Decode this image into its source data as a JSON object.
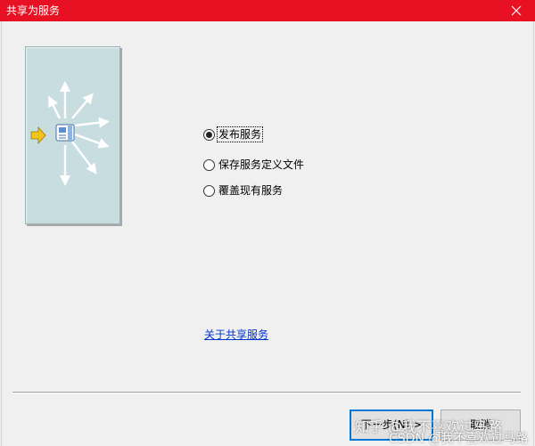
{
  "window": {
    "title": "共享为服务",
    "close_icon": "close-icon"
  },
  "illustration": {
    "icon": "publish-service-illustration"
  },
  "options": [
    {
      "label": "发布服务",
      "checked": true
    },
    {
      "label": "保存服务定义文件",
      "checked": false
    },
    {
      "label": "覆盖现有服务",
      "checked": false
    }
  ],
  "about_link": "关于共享服务",
  "buttons": {
    "next": "下一步(N) >",
    "cancel": "取消"
  },
  "watermark": {
    "line1": "知乎 @我不喜欢过马路",
    "line2": "CSDN @我不喜欢过马路"
  },
  "colors": {
    "titlebar": "#e81123",
    "link": "#0033cc",
    "primary_border": "#0078d7"
  }
}
